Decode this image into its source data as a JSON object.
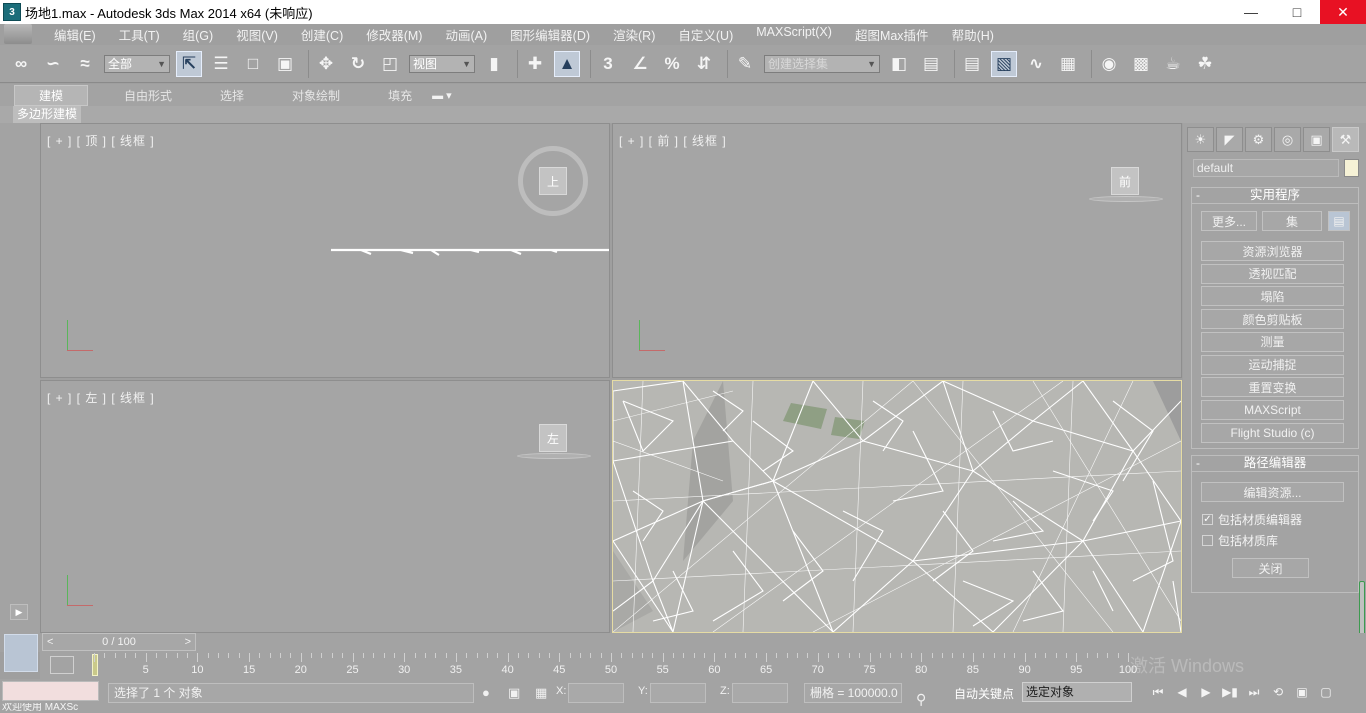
{
  "window": {
    "title": "场地1.max - Autodesk 3ds Max  2014 x64   (未响应)",
    "app_icon": "3ds-max-icon",
    "controls": [
      "minimize",
      "maximize",
      "close"
    ]
  },
  "menu": {
    "items": [
      "编辑(E)",
      "工具(T)",
      "组(G)",
      "视图(V)",
      "创建(C)",
      "修改器(M)",
      "动画(A)",
      "图形编辑器(D)",
      "渲染(R)",
      "自定义(U)",
      "MAXScript(X)",
      "超图Max插件",
      "帮助(H)"
    ]
  },
  "toolbar": {
    "selection_filter": "全部",
    "reference_coord": "视图",
    "named_selection_placeholder": "创建选择集",
    "snap_labels": [
      "3",
      "%"
    ]
  },
  "ribbon": {
    "tabs": [
      "建模",
      "自由形式",
      "选择",
      "对象绘制",
      "填充"
    ],
    "active_tab": "建模",
    "panel_label": "多边形建模"
  },
  "viewports": {
    "top": {
      "label": "[ + ] [ 顶 ] [ 线框 ]",
      "cube": "上"
    },
    "front": {
      "label": "[ + ] [ 前 ] [ 线框 ]",
      "cube": "前"
    },
    "left": {
      "label": "[ + ] [ 左 ] [ 线框 ]",
      "cube": "左"
    },
    "perspective": {
      "label": "",
      "wireframe_color": "#ffffff",
      "fill_color": "#b6b6b2"
    }
  },
  "command_panel": {
    "object_name": "default",
    "swatch_color": "#f6f2d6",
    "utilities": {
      "title": "实用程序",
      "more_button": "更多...",
      "sets_button": "集",
      "buttons": [
        "资源浏览器",
        "透视匹配",
        "塌陷",
        "颜色剪贴板",
        "测量",
        "运动捕捉",
        "重置变换",
        "MAXScript",
        "Flight Studio (c)"
      ]
    },
    "path_editor": {
      "title": "路径编辑器",
      "edit_button": "编辑资源...",
      "check_material_editor": "包括材质编辑器",
      "check_material_library": "包括材质库",
      "check_material_editor_checked": true,
      "check_material_library_checked": false,
      "close_button": "关闭"
    }
  },
  "timeline": {
    "frame_counter": "0 / 100",
    "prev": "<",
    "next": ">",
    "ticks": [
      "5",
      "10",
      "15",
      "20",
      "25",
      "30",
      "35",
      "40",
      "45",
      "50",
      "55",
      "60",
      "65",
      "70",
      "75",
      "80",
      "85",
      "90",
      "95",
      "100"
    ],
    "watermark": "激活 Windows"
  },
  "status": {
    "maxscript_welcome": "欢迎使用 MAXSc",
    "selection_text": "选择了 1 个 对象",
    "x_label": "X:",
    "y_label": "Y:",
    "z_label": "Z:",
    "grid": "栅格 = 100000.0",
    "auto_key": "自动关键点",
    "selection_set": "选定对象"
  }
}
